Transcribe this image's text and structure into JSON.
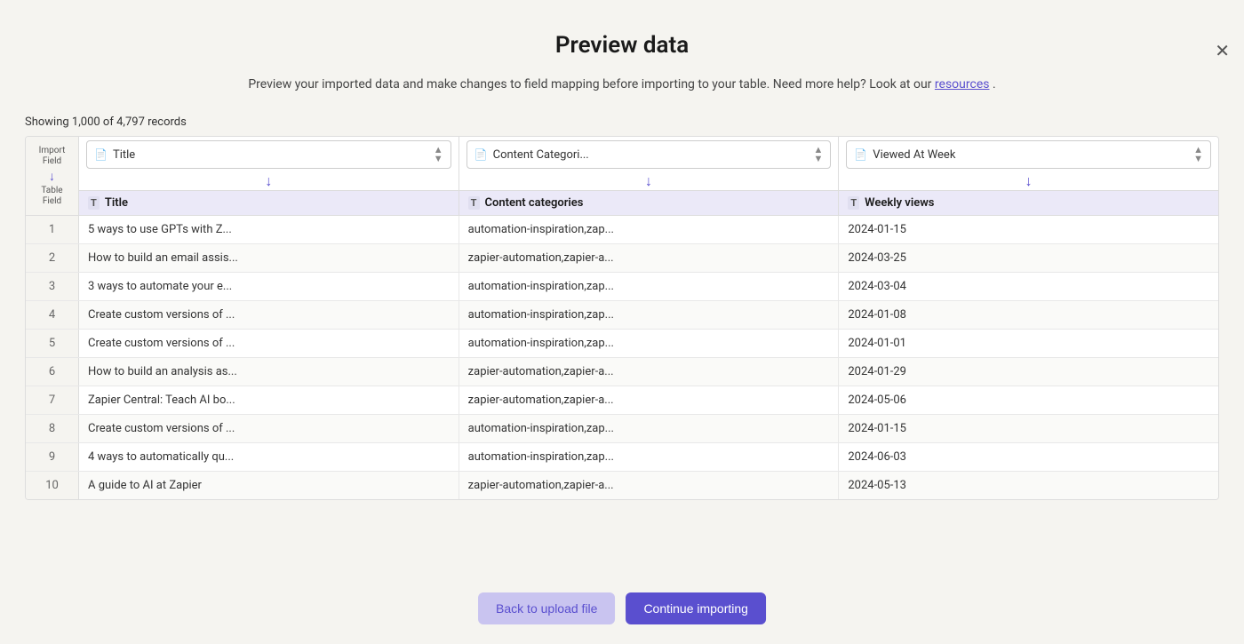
{
  "page": {
    "title": "Preview data",
    "subtitle_before_link": "Preview your imported data and make changes to field mapping before importing to your table. Need more help? Look at our",
    "subtitle_link_text": "resources",
    "subtitle_after_link": ".",
    "records_count": "Showing 1,000 of 4,797 records"
  },
  "columns": [
    {
      "import_field": "Title",
      "table_field": "Title",
      "field_type": "T"
    },
    {
      "import_field": "Content Categori...",
      "table_field": "Content categories",
      "field_type": "T"
    },
    {
      "import_field": "Viewed At Week",
      "table_field": "Weekly views",
      "field_type": "T"
    }
  ],
  "left_labels": {
    "import_field": "Import Field",
    "table_field": "Table Field"
  },
  "rows": [
    {
      "num": "1",
      "title": "5 ways to use GPTs with Z...",
      "categories": "automation-inspiration,zap...",
      "weekly_views": "2024-01-15"
    },
    {
      "num": "2",
      "title": "How to build an email assis...",
      "categories": "zapier-automation,zapier-a...",
      "weekly_views": "2024-03-25"
    },
    {
      "num": "3",
      "title": "3 ways to automate your e...",
      "categories": "automation-inspiration,zap...",
      "weekly_views": "2024-03-04"
    },
    {
      "num": "4",
      "title": "Create custom versions of ...",
      "categories": "automation-inspiration,zap...",
      "weekly_views": "2024-01-08"
    },
    {
      "num": "5",
      "title": "Create custom versions of ...",
      "categories": "automation-inspiration,zap...",
      "weekly_views": "2024-01-01"
    },
    {
      "num": "6",
      "title": "How to build an analysis as...",
      "categories": "zapier-automation,zapier-a...",
      "weekly_views": "2024-01-29"
    },
    {
      "num": "7",
      "title": "Zapier Central: Teach AI bo...",
      "categories": "zapier-automation,zapier-a...",
      "weekly_views": "2024-05-06"
    },
    {
      "num": "8",
      "title": "Create custom versions of ...",
      "categories": "automation-inspiration,zap...",
      "weekly_views": "2024-01-15"
    },
    {
      "num": "9",
      "title": "4 ways to automatically qu...",
      "categories": "automation-inspiration,zap...",
      "weekly_views": "2024-06-03"
    },
    {
      "num": "10",
      "title": "A guide to AI at Zapier",
      "categories": "zapier-automation,zapier-a...",
      "weekly_views": "2024-05-13"
    }
  ],
  "buttons": {
    "back": "Back to upload file",
    "continue": "Continue importing"
  },
  "close_icon": "✕",
  "colors": {
    "accent": "#5a4fcf",
    "accent_light": "#c9c4f0",
    "bg": "#f5f4f0"
  }
}
